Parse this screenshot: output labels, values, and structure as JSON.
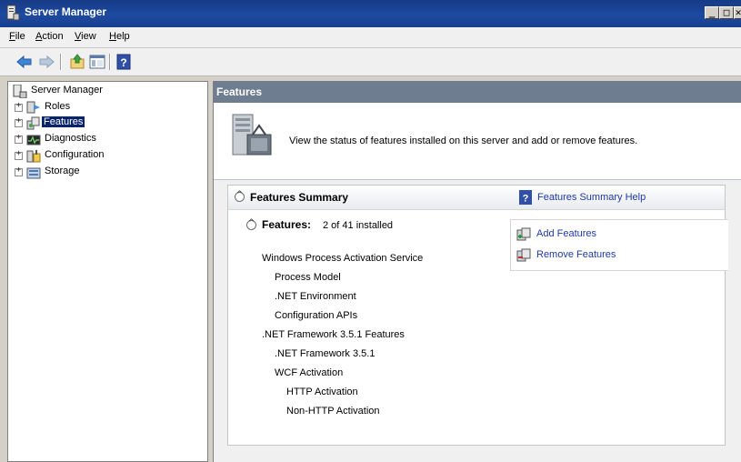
{
  "window": {
    "title": "Server Manager"
  },
  "caption_buttons": {
    "minimize": "_",
    "maximize": "□",
    "close": "✕"
  },
  "menu": [
    {
      "label": "File",
      "accel": "F",
      "rest": "ile"
    },
    {
      "label": "Action",
      "accel": "A",
      "rest": "ction"
    },
    {
      "label": "View",
      "accel": "V",
      "rest": "iew"
    },
    {
      "label": "Help",
      "accel": "H",
      "rest": "elp"
    }
  ],
  "toolbar": {
    "icons": [
      "back-arrow-icon",
      "forward-arrow-icon",
      "up-folder-icon",
      "show-hide-console-tree-icon",
      "help-icon"
    ]
  },
  "tree": {
    "root": "Server Manager",
    "items": [
      {
        "label": "Roles",
        "icon": "roles-icon"
      },
      {
        "label": "Features",
        "icon": "features-icon",
        "selected": true
      },
      {
        "label": "Diagnostics",
        "icon": "diagnostics-icon"
      },
      {
        "label": "Configuration",
        "icon": "configuration-icon"
      },
      {
        "label": "Storage",
        "icon": "storage-icon"
      }
    ],
    "expand_glyph": "+"
  },
  "main": {
    "header": "Features",
    "intro": "View the status of features installed on this server and add or remove features.",
    "summary": {
      "title": "Features Summary",
      "help_link": "Features Summary Help",
      "collapse_glyph": "^",
      "features_label": "Features:",
      "features_count": "2 of 41 installed",
      "actions": {
        "add": "Add Features",
        "remove": "Remove Features"
      },
      "installed": [
        {
          "name": "Windows Process Activation Service",
          "level": 0
        },
        {
          "name": "Process Model",
          "level": 1
        },
        {
          "name": ".NET Environment",
          "level": 1
        },
        {
          "name": "Configuration APIs",
          "level": 1
        },
        {
          "name": ".NET Framework 3.5.1 Features",
          "level": 0
        },
        {
          "name": ".NET Framework 3.5.1",
          "level": 1
        },
        {
          "name": "WCF Activation",
          "level": 1
        },
        {
          "name": "HTTP Activation",
          "level": 2
        },
        {
          "name": "Non-HTTP Activation",
          "level": 2
        }
      ]
    }
  }
}
